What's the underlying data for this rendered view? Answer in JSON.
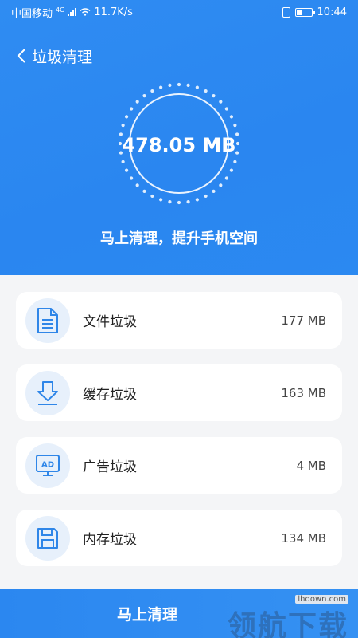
{
  "status_bar": {
    "carrier": "中国移动",
    "network": "4G",
    "speed": "11.7K/s",
    "time": "10:44"
  },
  "header": {
    "title": "垃圾清理",
    "back_icon": "chevron-left-icon"
  },
  "summary": {
    "total_size": "478.05 MB",
    "subtitle": "马上清理，提升手机空间"
  },
  "items": [
    {
      "label": "文件垃圾",
      "size": "177 MB",
      "icon": "document-icon"
    },
    {
      "label": "缓存垃圾",
      "size": "163 MB",
      "icon": "download-icon"
    },
    {
      "label": "广告垃圾",
      "size": "4 MB",
      "icon": "ad-monitor-icon"
    },
    {
      "label": "内存垃圾",
      "size": "134 MB",
      "icon": "floppy-disk-icon"
    }
  ],
  "action": {
    "clean_label": "马上清理"
  },
  "watermark": {
    "url": "lhdown.com",
    "text": "领航下载"
  },
  "colors": {
    "primary": "#2b89f1",
    "icon_bg": "#e7f0fb",
    "icon_stroke": "#2f86e8"
  }
}
